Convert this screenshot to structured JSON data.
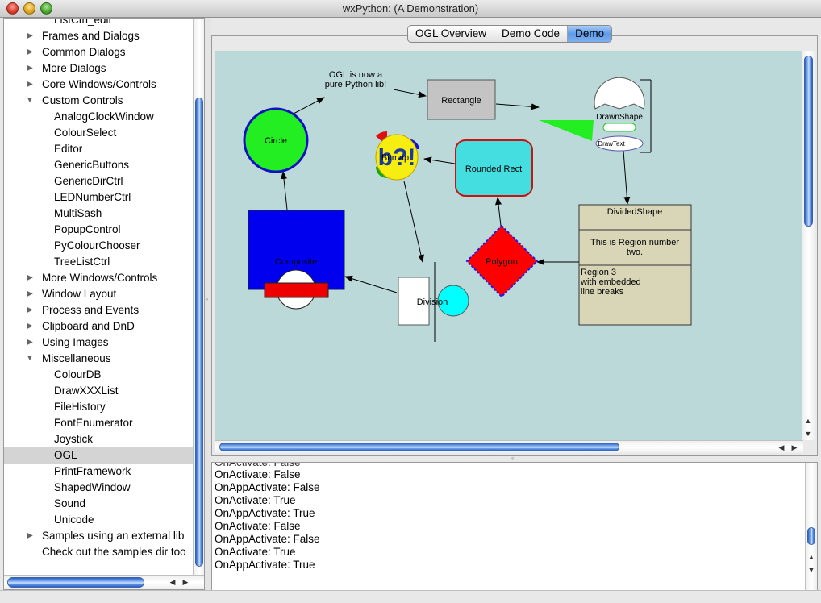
{
  "window": {
    "title": "wxPython: (A Demonstration)"
  },
  "tree": {
    "items": [
      {
        "label": "ListCtrl_edit",
        "indent": 2,
        "arrow": ""
      },
      {
        "label": "Frames and Dialogs",
        "indent": 1,
        "arrow": "right"
      },
      {
        "label": "Common Dialogs",
        "indent": 1,
        "arrow": "right"
      },
      {
        "label": "More Dialogs",
        "indent": 1,
        "arrow": "right"
      },
      {
        "label": "Core Windows/Controls",
        "indent": 1,
        "arrow": "right"
      },
      {
        "label": "Custom Controls",
        "indent": 1,
        "arrow": "down"
      },
      {
        "label": "AnalogClockWindow",
        "indent": 2,
        "arrow": ""
      },
      {
        "label": "ColourSelect",
        "indent": 2,
        "arrow": ""
      },
      {
        "label": "Editor",
        "indent": 2,
        "arrow": ""
      },
      {
        "label": "GenericButtons",
        "indent": 2,
        "arrow": ""
      },
      {
        "label": "GenericDirCtrl",
        "indent": 2,
        "arrow": ""
      },
      {
        "label": "LEDNumberCtrl",
        "indent": 2,
        "arrow": ""
      },
      {
        "label": "MultiSash",
        "indent": 2,
        "arrow": ""
      },
      {
        "label": "PopupControl",
        "indent": 2,
        "arrow": ""
      },
      {
        "label": "PyColourChooser",
        "indent": 2,
        "arrow": ""
      },
      {
        "label": "TreeListCtrl",
        "indent": 2,
        "arrow": ""
      },
      {
        "label": "More Windows/Controls",
        "indent": 1,
        "arrow": "right"
      },
      {
        "label": "Window Layout",
        "indent": 1,
        "arrow": "right"
      },
      {
        "label": "Process and Events",
        "indent": 1,
        "arrow": "right"
      },
      {
        "label": "Clipboard and DnD",
        "indent": 1,
        "arrow": "right"
      },
      {
        "label": "Using Images",
        "indent": 1,
        "arrow": "right"
      },
      {
        "label": "Miscellaneous",
        "indent": 1,
        "arrow": "down"
      },
      {
        "label": "ColourDB",
        "indent": 2,
        "arrow": ""
      },
      {
        "label": "DrawXXXList",
        "indent": 2,
        "arrow": ""
      },
      {
        "label": "FileHistory",
        "indent": 2,
        "arrow": ""
      },
      {
        "label": "FontEnumerator",
        "indent": 2,
        "arrow": ""
      },
      {
        "label": "Joystick",
        "indent": 2,
        "arrow": ""
      },
      {
        "label": "OGL",
        "indent": 2,
        "arrow": "",
        "selected": true
      },
      {
        "label": "PrintFramework",
        "indent": 2,
        "arrow": ""
      },
      {
        "label": "ShapedWindow",
        "indent": 2,
        "arrow": ""
      },
      {
        "label": "Sound",
        "indent": 2,
        "arrow": ""
      },
      {
        "label": "Unicode",
        "indent": 2,
        "arrow": ""
      },
      {
        "label": "Samples using an external lib",
        "indent": 1,
        "arrow": "right"
      },
      {
        "label": "Check out the samples dir too",
        "indent": 1,
        "arrow": ""
      }
    ]
  },
  "tabs": [
    {
      "label": "OGL Overview",
      "active": false
    },
    {
      "label": "Demo Code",
      "active": false
    },
    {
      "label": "Demo",
      "active": true
    }
  ],
  "canvas": {
    "ogl_note": [
      "OGL is now a",
      "pure Python lib!"
    ],
    "rectangle": "Rectangle",
    "circle": "Circle",
    "bitmap": "Bitmap",
    "rounded_rect": "Rounded Rect",
    "drawn_shape": "DrawnShape",
    "draw_text": "DrawText",
    "divided_title": "DividedShape",
    "divided_region2": [
      "This is Region number",
      "two."
    ],
    "divided_region3": [
      "Region 3",
      "with embedded",
      "line breaks"
    ],
    "composite": "Composite",
    "division": "Division",
    "polygon": "Polygon"
  },
  "log": {
    "lines": [
      "OnActivate: False",
      "OnAppActivate: False",
      "OnActivate: True",
      "OnAppActivate: True",
      "OnActivate: False",
      "OnAppActivate: False",
      "OnActivate: True",
      "OnAppActivate: True"
    ]
  },
  "colors": {
    "canvas_bg": "#bcd9da",
    "circle_fill": "#22ee22",
    "circle_stroke": "#1010c0",
    "composite_fill": "#0000ee",
    "composite_bar": "#ee0000",
    "rounded_fill": "#44dde0",
    "rounded_stroke": "#cc1111",
    "polygon_fill": "#ff0000",
    "polygon_stroke": "#1a1aee",
    "divided_fill": "#d9d6b8",
    "rectangle_fill": "#c4c4c4",
    "cyan_circle": "#00ffff"
  }
}
